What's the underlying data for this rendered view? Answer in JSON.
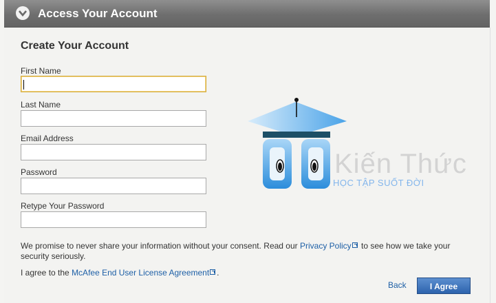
{
  "header": {
    "title": "Access Your Account",
    "icon": "chevron-down-icon"
  },
  "form": {
    "heading": "Create Your Account",
    "fields": [
      {
        "label": "First Name",
        "value": "",
        "placeholder": ""
      },
      {
        "label": "Last Name",
        "value": "",
        "placeholder": ""
      },
      {
        "label": "Email Address",
        "value": "",
        "placeholder": ""
      },
      {
        "label": "Password",
        "value": "",
        "placeholder": ""
      },
      {
        "label": "Retype Your Password",
        "value": "",
        "placeholder": ""
      }
    ]
  },
  "privacy": {
    "prefix": "We promise to never share your information without your consent. Read our",
    "link": "Privacy Policy",
    "suffix_line1": "to see how we take your",
    "suffix_line2": "security seriously."
  },
  "license": {
    "prefix": "I agree to the",
    "link": "McAfee End User License Agreement",
    "suffix": "."
  },
  "actions": {
    "back": "Back",
    "agree": "I Agree"
  },
  "watermark": {
    "title": "Kiến Thức",
    "subtitle": "HỌC TẬP SUỐT ĐỜI"
  },
  "colors": {
    "accent": "#2d63ad",
    "link": "#1d5fa6",
    "header": "#6e6e6e",
    "focus_border": "#d4a935"
  }
}
